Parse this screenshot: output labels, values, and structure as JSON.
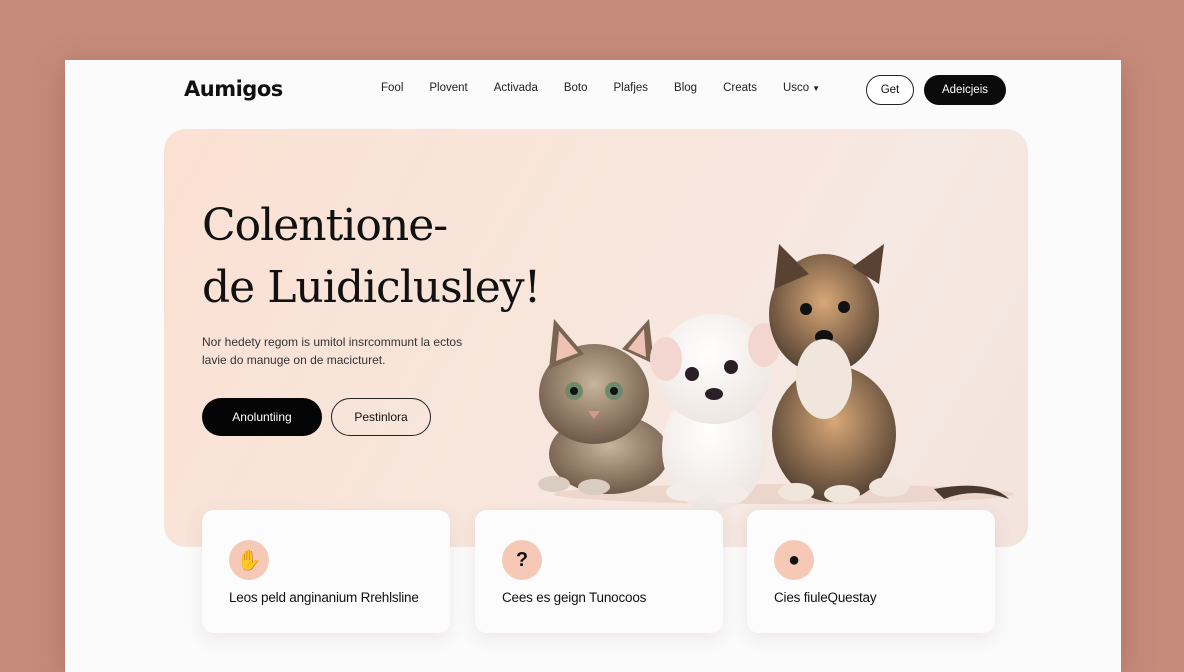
{
  "brand": {
    "logo": "Aumigos"
  },
  "nav": {
    "links": [
      "Fool",
      "Plovent",
      "Activada",
      "Boto",
      "Plafjes",
      "Blog",
      "Creats",
      "Usco"
    ],
    "get_label": "Get",
    "adopt_label": "Adeicjeis"
  },
  "hero": {
    "headline_line1": "Colentione-",
    "headline_line2": "de Luidiclusley!",
    "subtext_line1": "Nor hedety regom is umitol insrcommunt la ectos",
    "subtext_line2": "lavie do manuge on de macicturet.",
    "primary_label": "Anoluntiing",
    "secondary_label": "Pestinlora"
  },
  "features": [
    {
      "icon": "hand-icon",
      "title": "Leos peld anginanium Rrehlsline"
    },
    {
      "icon": "question-icon",
      "title": "Cees es geign Tunocoos"
    },
    {
      "icon": "person-icon",
      "title": "Cies fiuleQuestay"
    }
  ],
  "colors": {
    "background": "#c78b7b",
    "accent": "#f6c9b6",
    "dark": "#0b0b0b"
  }
}
